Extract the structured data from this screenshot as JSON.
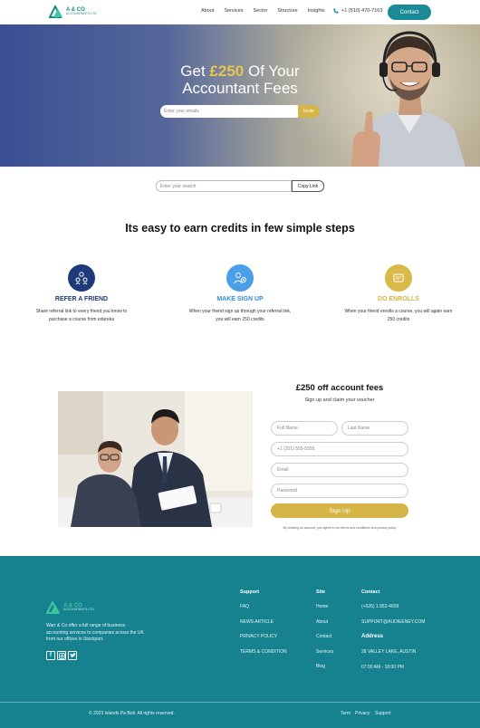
{
  "header": {
    "brand": "A & CO",
    "brand_sub": "ACCOUNTANTS LTD",
    "nav": [
      "About",
      "Services",
      "Sector",
      "Structure",
      "Insights"
    ],
    "phone": "+1 (510) 470-7163",
    "contact_label": "Contact"
  },
  "hero": {
    "title_pre": "Get",
    "title_amount": "£250",
    "title_post": "Of Your",
    "title_line2": "Accountant Fees",
    "search_placeholder": "Enter your emails",
    "invite_label": "Invite"
  },
  "referral": {
    "placeholder": "Enter your search",
    "copy_label": "Copy Link"
  },
  "steps_title": "Its easy to earn credits in few simple steps",
  "steps": [
    {
      "title": "REFER A FRIEND",
      "desc": "Share referral link to every friend you know to purchase a course from edureka",
      "color": "#1e3a7a",
      "title_color": "#1e3a7a",
      "icon": "friends-icon"
    },
    {
      "title": "MAKE SIGN UP",
      "desc": "When your friend sign up through your referral link, you will earn 250 credits",
      "color": "#4a9fe8",
      "title_color": "#2f8ed8",
      "icon": "signup-icon"
    },
    {
      "title": "DO ENROLLS",
      "desc": "When your friend enrolls a course, you will again earn 250 credits",
      "color": "#d9b94a",
      "title_color": "#d4b545",
      "icon": "enroll-icon"
    }
  ],
  "signup": {
    "title": "£250 off account fees",
    "subtitle": "Sign up and claim your voucher",
    "first_name": "Full Name",
    "last_name": "Last Name",
    "phone": "+1 (201) 555-5555",
    "email": "Email",
    "password": "Password",
    "button": "Sign Up",
    "note": "By creating an account, you agree to our terms and conditions and privacy policy"
  },
  "footer": {
    "brand": "A & CO",
    "brand_sub": "ACCOUNTANTS LTD",
    "about": "Warr & Co offer a full range of business accounting services to companies across the UK from our offices in Stockport.",
    "support_title": "Support",
    "support_links": [
      "FAQ",
      "NEWS ARTICLE",
      "PRIVACY POLICY",
      "TERMS & CONDITION"
    ],
    "site_title": "Site",
    "site_links": [
      "Home",
      "About",
      "Contact",
      "Services",
      "Blog"
    ],
    "contact_title": "Contact",
    "contact_phone": "(+626) 1 852-4609",
    "contact_email": "SUPPORT@AUDIEENEY.COM",
    "address_title": "Address",
    "address": "28 VALLEY LAKE, AUSTIN",
    "hours": "07:00 AM - 18:00 PM",
    "copyright": "© 2023 Islands Pa Bolt. All rights reserved.",
    "legal": [
      "Term",
      "Privacy",
      "Support"
    ]
  }
}
